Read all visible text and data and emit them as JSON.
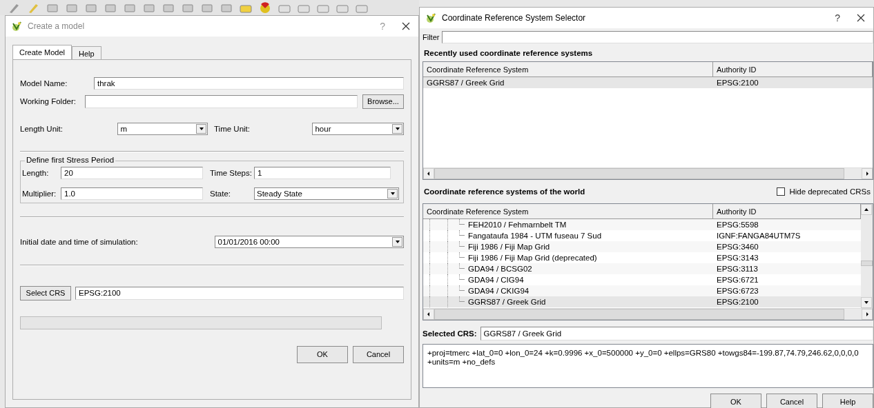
{
  "model_dialog": {
    "title": "Create a model",
    "help_glyph": "?",
    "tabs": [
      {
        "label": "Create Model",
        "selected": true
      },
      {
        "label": "Help",
        "selected": false
      }
    ],
    "model_name": {
      "label": "Model Name:",
      "value": "thrak"
    },
    "working_folder": {
      "label": "Working Folder:"
    },
    "browse_button": "Browse...",
    "length_unit": {
      "label": "Length Unit:",
      "value": "m"
    },
    "time_unit": {
      "label": "Time Unit:",
      "value": "hour"
    },
    "stress_period": {
      "title": "Define first Stress Period",
      "length": {
        "label": "Length:",
        "value": "20"
      },
      "time_steps": {
        "label": "Time Steps:",
        "value": "1"
      },
      "multiplier": {
        "label": "Multiplier:",
        "value": "1.0"
      },
      "state": {
        "label": "State:",
        "value": "Steady State"
      }
    },
    "initial_date": {
      "label": "Initial date and time of simulation:",
      "value": "01/01/2016 00:00"
    },
    "select_crs_button": "Select CRS",
    "crs_value": "EPSG:2100",
    "progress": {
      "level": 0
    },
    "buttons": [
      "OK",
      "Cancel"
    ]
  },
  "crs_dialog": {
    "title": "Coordinate Reference System Selector",
    "help_glyph": "?",
    "filter_label": "Filter",
    "recent": {
      "heading": "Recently used coordinate reference systems",
      "columns": [
        "Coordinate Reference System",
        "Authority ID"
      ],
      "rows": [
        {
          "crs": "GGRS87 / Greek Grid",
          "authority_id": "EPSG:2100",
          "selected": true
        }
      ]
    },
    "world": {
      "heading": "Coordinate reference systems of the world",
      "hide_deprecated": {
        "label": "Hide deprecated CRSs",
        "checked": false
      },
      "columns": [
        "Coordinate Reference System",
        "Authority ID"
      ],
      "rows": [
        {
          "crs": "FEH2010 / Fehmarnbelt TM",
          "authority_id": "EPSG:5598",
          "selected": false
        },
        {
          "crs": "Fangataufa 1984 - UTM fuseau 7 Sud",
          "authority_id": "IGNF:FANGA84UTM7S",
          "selected": false
        },
        {
          "crs": "Fiji 1986 / Fiji Map Grid",
          "authority_id": "EPSG:3460",
          "selected": false
        },
        {
          "crs": "Fiji 1986 / Fiji Map Grid (deprecated)",
          "authority_id": "EPSG:3143",
          "selected": false
        },
        {
          "crs": "GDA94 / BCSG02",
          "authority_id": "EPSG:3113",
          "selected": false
        },
        {
          "crs": "GDA94 / CIG94",
          "authority_id": "EPSG:6721",
          "selected": false
        },
        {
          "crs": "GDA94 / CKIG94",
          "authority_id": "EPSG:6723",
          "selected": false
        },
        {
          "crs": "GGRS87 / Greek Grid",
          "authority_id": "EPSG:2100",
          "selected": true
        }
      ]
    },
    "selected_crs": {
      "label": "Selected CRS:",
      "value": "GGRS87 / Greek Grid"
    },
    "proj_definition": "+proj=tmerc +lat_0=0 +lon_0=24 +k=0.9996 +x_0=500000 +y_0=0 +ellps=GRS80 +towgs84=-199.87,74.79,246.62,0,0,0,0 +units=m +no_defs",
    "buttons": [
      "OK",
      "Cancel",
      "Help"
    ]
  }
}
